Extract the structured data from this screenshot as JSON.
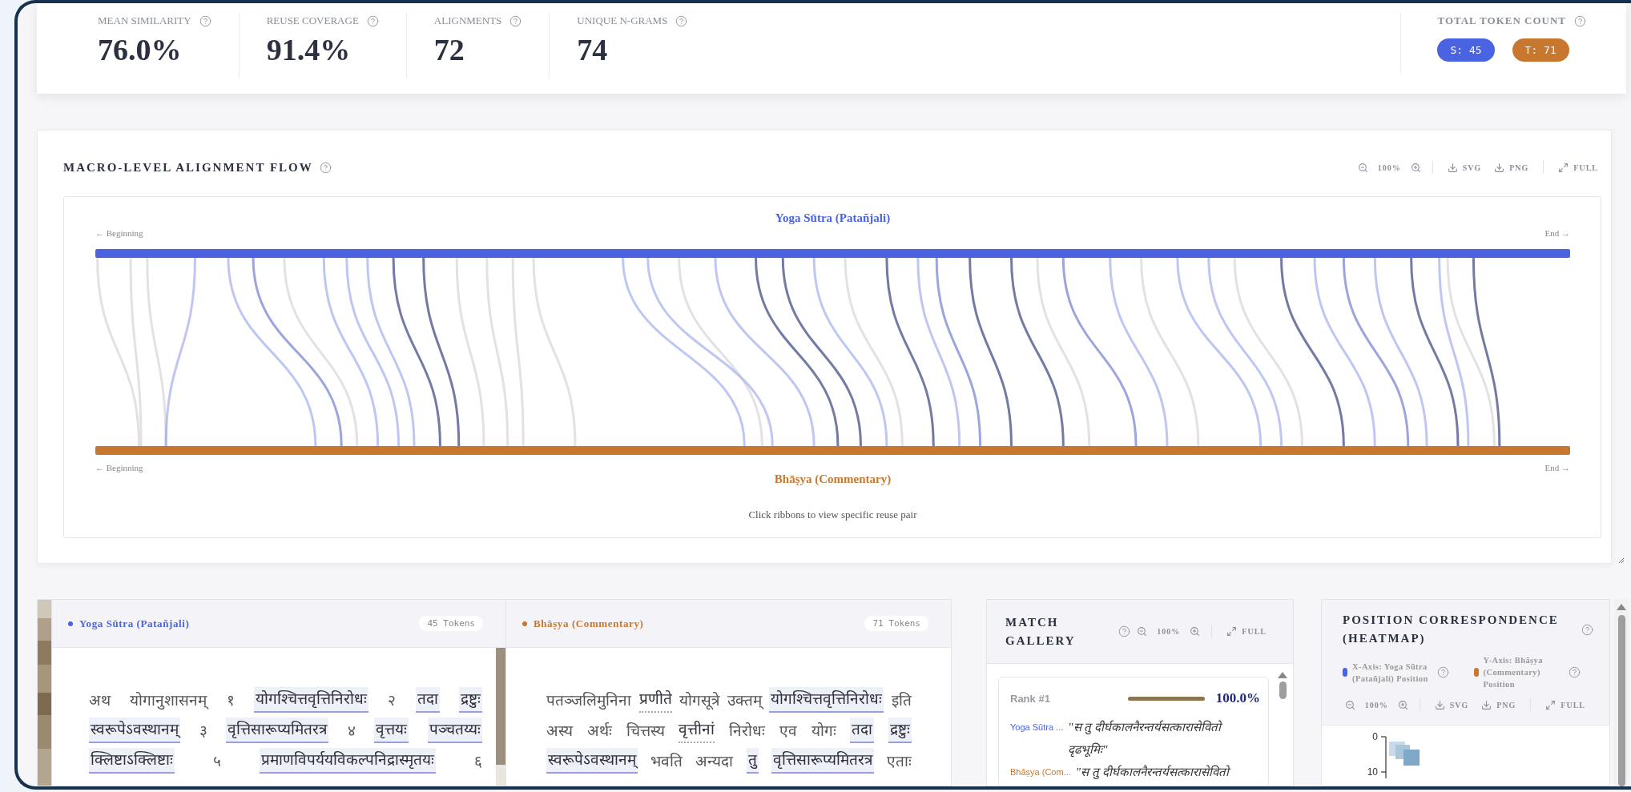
{
  "stats": [
    {
      "label": "MEAN SIMILARITY",
      "value": "76.0%"
    },
    {
      "label": "REUSE COVERAGE",
      "value": "91.4%"
    },
    {
      "label": "ALIGNMENTS",
      "value": "72"
    },
    {
      "label": "UNIQUE N-GRAMS",
      "value": "74"
    }
  ],
  "token_total": {
    "label": "TOTAL TOKEN COUNT",
    "badges": [
      {
        "text": "S: 45",
        "color": "#4a63e0"
      },
      {
        "text": "T: 71",
        "color": "#c8782e"
      }
    ]
  },
  "flow": {
    "title": "MACRO-LEVEL ALIGNMENT FLOW",
    "zoom": "100%",
    "buttons": [
      {
        "label": "SVG",
        "kind": "download"
      },
      {
        "label": "PNG",
        "kind": "download"
      },
      {
        "label": "FULL",
        "kind": "expand"
      }
    ],
    "source": {
      "name": "Yoga Sūtra (Patañjali)",
      "start": "← Beginning",
      "end": "End →"
    },
    "target": {
      "name": "Bhāṣya (Commentary)",
      "start": "← Beginning",
      "end": "End →"
    },
    "hint": "Click ribbons to view specific reuse pair"
  },
  "panels": [
    {
      "name": "Yoga Sūtra (Patañjali)",
      "color": "#4a63e0",
      "tokens": "45 Tokens",
      "lines": [
        [
          {
            "text": "अथ",
            "kind": "plain"
          },
          {
            "text": "योगानुशासनम्",
            "kind": "plain"
          },
          {
            "text": "१",
            "kind": "plain"
          },
          {
            "text": "योगश्चित्तवृत्तिनिरोधः",
            "kind": "match"
          },
          {
            "text": "२",
            "kind": "plain"
          },
          {
            "text": "तदा",
            "kind": "match"
          },
          {
            "text": "द्रष्टुः",
            "kind": "match"
          }
        ],
        [
          {
            "text": "स्वरूपेऽवस्थानम्",
            "kind": "match"
          },
          {
            "text": "३",
            "kind": "plain"
          },
          {
            "text": "वृत्तिसारूप्यमितरत्र",
            "kind": "match"
          },
          {
            "text": "४",
            "kind": "plain"
          },
          {
            "text": "वृत्तयः",
            "kind": "match"
          },
          {
            "text": "पञ्चतय्यः",
            "kind": "match"
          }
        ],
        [
          {
            "text": "क्लिष्टाऽक्लिष्टाः",
            "kind": "match"
          },
          {
            "text": "५",
            "kind": "plain"
          },
          {
            "text": "प्रमाणविपर्ययविकल्पनिद्रास्मृतयः",
            "kind": "match"
          },
          {
            "text": "६",
            "kind": "plain"
          }
        ]
      ]
    },
    {
      "name": "Bhāṣya (Commentary)",
      "color": "#c8782e",
      "tokens": "71 Tokens",
      "lines": [
        [
          {
            "text": "पतञ्जलिमुनिना",
            "kind": "plain"
          },
          {
            "text": "प्रणीते",
            "kind": "partial"
          },
          {
            "text": "योगसूत्रे",
            "kind": "plain"
          },
          {
            "text": "उक्तम्",
            "kind": "plain"
          },
          {
            "text": "योगश्चित्तवृत्तिनिरोधः",
            "kind": "match"
          },
          {
            "text": "इति",
            "kind": "plain"
          }
        ],
        [
          {
            "text": "अस्य",
            "kind": "plain"
          },
          {
            "text": "अर्थः",
            "kind": "plain"
          },
          {
            "text": "चित्तस्य",
            "kind": "plain"
          },
          {
            "text": "वृत्तीनां",
            "kind": "partial"
          },
          {
            "text": "निरोधः",
            "kind": "plain"
          },
          {
            "text": "एव",
            "kind": "plain"
          },
          {
            "text": "योगः",
            "kind": "plain"
          },
          {
            "text": "तदा",
            "kind": "match"
          },
          {
            "text": "द्रष्टुः",
            "kind": "match"
          }
        ],
        [
          {
            "text": "स्वरूपेऽवस्थानम्",
            "kind": "match"
          },
          {
            "text": "भवति",
            "kind": "plain"
          },
          {
            "text": "अन्यदा",
            "kind": "plain"
          },
          {
            "text": "तु",
            "kind": "match"
          },
          {
            "text": "वृत्तिसारूप्यमितरत्र",
            "kind": "match"
          },
          {
            "text": "एताः",
            "kind": "plain"
          }
        ]
      ]
    }
  ],
  "gallery": {
    "title": "MATCH GALLERY",
    "zoom": "100%",
    "buttons": [
      {
        "label": "FULL",
        "kind": "expand"
      }
    ],
    "matches": [
      {
        "rank": "Rank #1",
        "score": "100.0%",
        "source_label": "Yoga Sūtra ...",
        "source_quote": "\"स तु दीर्घकालनैरन्तर्यसत्कारासेवितो दृढभूमिः\"",
        "target_label": "Bhāṣya (Com...",
        "target_quote": "\"स तु दीर्घकालनैरन्तर्यसत्कारासेवितो"
      }
    ]
  },
  "heatmap": {
    "title": "POSITION CORRESPONDENCE (HEATMAP)",
    "legend": [
      {
        "text": "X-Axis: Yoga Sūtra (Patañjali) Position",
        "color": "#4a63e0"
      },
      {
        "text": "Y-Axis: Bhāṣya (Commentary) Position",
        "color": "#c8782e"
      }
    ],
    "zoom": "100%",
    "buttons": [
      {
        "label": "SVG",
        "kind": "download"
      },
      {
        "label": "PNG",
        "kind": "download"
      },
      {
        "label": "FULL",
        "kind": "expand"
      }
    ],
    "yticks": [
      "0",
      "10"
    ]
  }
}
